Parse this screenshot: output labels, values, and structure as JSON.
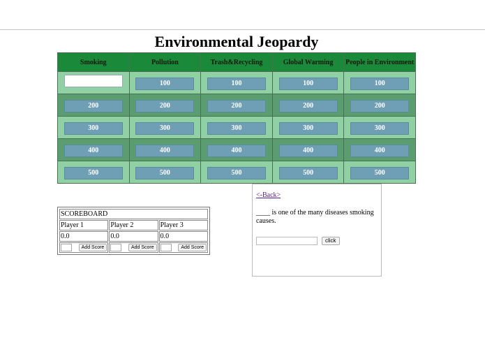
{
  "page": {
    "title": "Environmental Jeopardy"
  },
  "board": {
    "categories": [
      "Smoking",
      "Pollution",
      "Trash&Recycling",
      "Global Warming",
      "People in Environment"
    ],
    "rows": [
      [
        "",
        "100",
        "100",
        "100",
        "100"
      ],
      [
        "200",
        "200",
        "200",
        "200",
        "200"
      ],
      [
        "300",
        "300",
        "300",
        "300",
        "300"
      ],
      [
        "400",
        "400",
        "400",
        "400",
        "400"
      ],
      [
        "500",
        "500",
        "500",
        "500",
        "500"
      ]
    ],
    "colors": {
      "header": "#1a8a3a",
      "row_light": "#8fd1a3",
      "row_dark": "#5a9e70",
      "button": "#6e9fb5"
    }
  },
  "scoreboard": {
    "title": "SCOREBOARD",
    "players": [
      {
        "name": "Player 1",
        "score": "0.0",
        "button": "Add Score"
      },
      {
        "name": "Player 2",
        "score": "0.0",
        "button": "Add Score"
      },
      {
        "name": "Player 3",
        "score": "0.0",
        "button": "Add Score"
      }
    ]
  },
  "question": {
    "back_label": "<-Back>",
    "text": "____ is one of the many diseases smoking causes.",
    "answer_value": "",
    "click_label": "click"
  }
}
